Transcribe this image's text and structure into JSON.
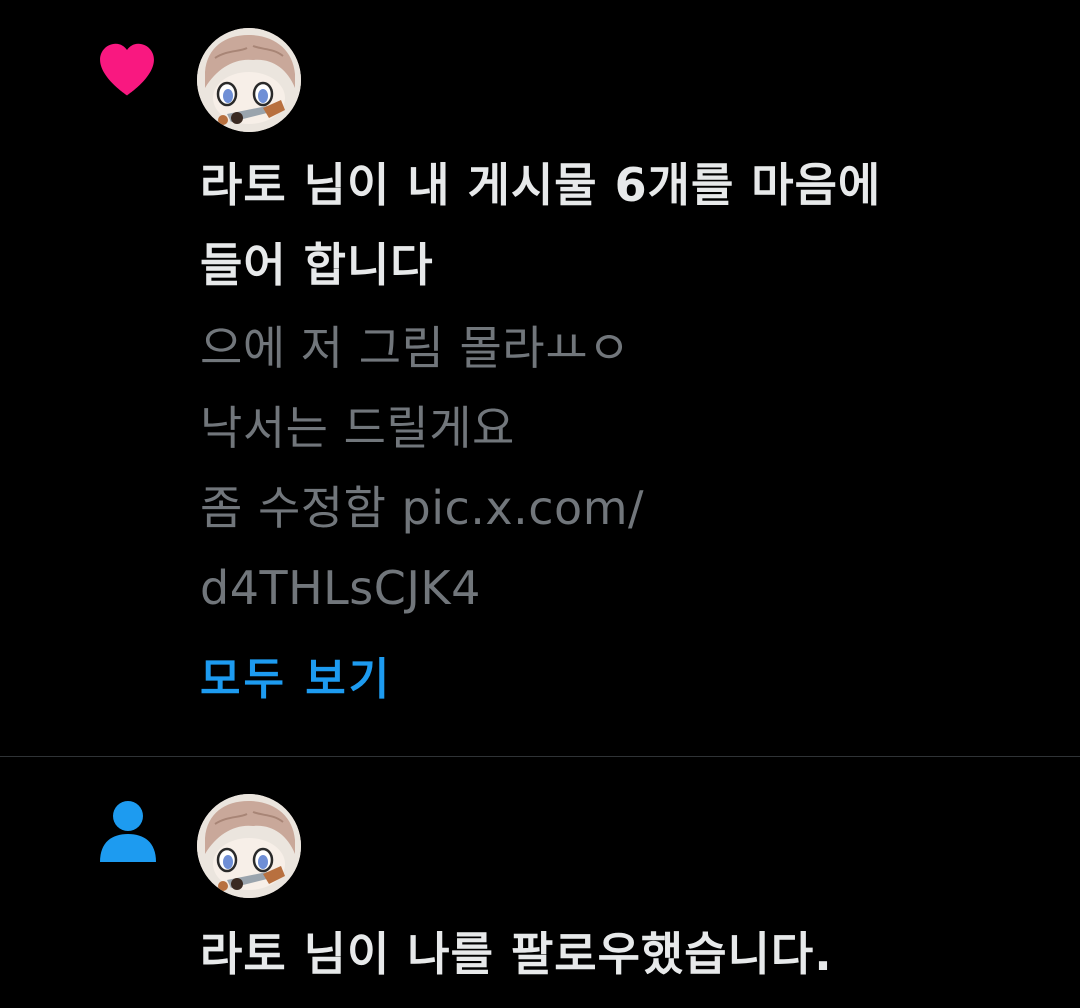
{
  "notifications": [
    {
      "type": "like",
      "icon": "heart-icon",
      "icon_color": "#f91880",
      "headline_lines": [
        "라토 님이 내 게시물 6개를 마음에",
        "들어 합니다"
      ],
      "post_lines": [
        "으에 저 그림 몰라ㅛㅇ",
        "낙서는 드릴게요",
        "좀 수정함 pic.x.com/",
        "d4THLsCJK4"
      ],
      "show_all_label": "모두 보기"
    },
    {
      "type": "follow",
      "icon": "person-icon",
      "icon_color": "#1d9bf0",
      "headline_lines": [
        "라토 님이 나를 팔로우했습니다."
      ]
    }
  ],
  "colors": {
    "background": "#000000",
    "primary_text": "#e7e9ea",
    "secondary_text": "#71767b",
    "accent": "#1d9bf0",
    "divider": "#2f3336"
  }
}
